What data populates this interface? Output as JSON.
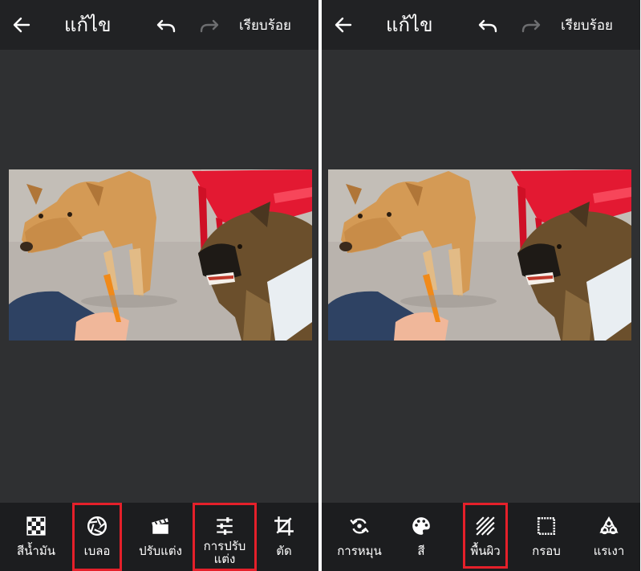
{
  "colors": {
    "topbar_bg": "#212224",
    "canvas_bg": "#2f3032",
    "toolbar_bg": "#1c1d1f",
    "highlight": "#e5202a",
    "text": "#ffffff",
    "disabled": "#6d6e70"
  },
  "left_panel": {
    "header": {
      "back_icon": "arrow-left-icon",
      "title": "แก้ไข",
      "undo_icon": "undo-icon",
      "redo_icon": "redo-icon",
      "done_label": "เรียบร้อย"
    },
    "tools": [
      {
        "label": "สีน้ำมัน",
        "icon": "checker-icon"
      },
      {
        "label": "เบลอ",
        "icon": "aperture-icon",
        "highlighted": true
      },
      {
        "label": "ปรับแต่ง",
        "icon": "clapper-icon"
      },
      {
        "label": "การปรับแต่ง",
        "icon": "sliders-icon",
        "highlighted": true
      },
      {
        "label": "ตัด",
        "icon": "crop-icon"
      }
    ]
  },
  "right_panel": {
    "header": {
      "back_icon": "arrow-left-icon",
      "title": "แก้ไข",
      "undo_icon": "undo-icon",
      "redo_icon": "redo-icon",
      "done_label": "เรียบร้อย"
    },
    "tools": [
      {
        "label": "การหมุน",
        "icon": "rotate-icon"
      },
      {
        "label": "สี",
        "icon": "palette-icon"
      },
      {
        "label": "พื้นผิว",
        "icon": "texture-icon",
        "highlighted": true
      },
      {
        "label": "กรอบ",
        "icon": "frame-icon"
      },
      {
        "label": "แรเงา",
        "icon": "vignette-icon"
      }
    ]
  }
}
